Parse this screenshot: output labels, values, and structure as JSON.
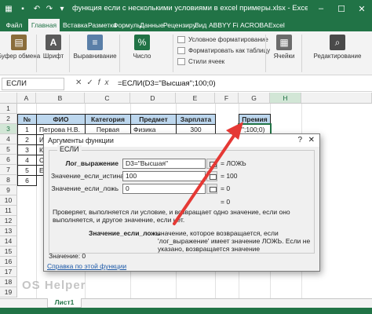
{
  "window": {
    "title": "функция если с несколькими условиями в excel примеры.xlsx - Excel",
    "save_icon": "save-icon",
    "undo_icon": "undo-icon",
    "redo_icon": "redo-icon",
    "accent": "#217346"
  },
  "ribbon_tabs": [
    "Файл",
    "Главная",
    "Вставка",
    "Разметка",
    "Формулы",
    "Данные",
    "Рецензиру",
    "Вид",
    "ABBYY Fi",
    "ACROBA",
    "Excel"
  ],
  "ribbon": {
    "clipboard": "Буфер обмена",
    "font": "Шрифт",
    "alignment": "Выравнивание",
    "number": "Число",
    "cond_format": "Условное форматирование",
    "format_table": "Форматировать как таблицу",
    "cell_styles": "Стили ячеек",
    "cells": "Ячейки",
    "editing": "Редактирование"
  },
  "formula_bar": {
    "name_box": "ЕСЛИ",
    "formula": "=ЕСЛИ(D3=\"Высшая\";100;0)"
  },
  "grid": {
    "columns": [
      "A",
      "B",
      "C",
      "D",
      "E",
      "F",
      "G",
      "H"
    ],
    "rows": [
      "1",
      "2",
      "3",
      "4",
      "5",
      "6",
      "7",
      "8",
      "9",
      "10",
      "11",
      "12",
      "13",
      "14",
      "15",
      "16",
      "17",
      "18",
      "19"
    ],
    "table_headers": [
      "№",
      "ФИО",
      "Категория",
      "Предмет",
      "Зарплата",
      "Премия"
    ],
    "row3": {
      "num": "1",
      "name": "Петрова Н.В.",
      "category": "Первая",
      "subject": "Физика",
      "salary": "300",
      "bonus": "\";100;0)"
    },
    "row_numbers": [
      "2",
      "3",
      "4",
      "5",
      "6"
    ],
    "name_initials": [
      "И",
      "К",
      "С",
      "Е"
    ]
  },
  "dialog": {
    "title": "Аргументы функции",
    "help": "?",
    "close": "✕",
    "function_name": "ЕСЛИ",
    "args": [
      {
        "label": "Лог_выражение",
        "value": "D3=\"Высшая\"",
        "result": "=  ЛОЖЬ"
      },
      {
        "label": "Значение_если_истина",
        "value": "100",
        "result": "=  100"
      },
      {
        "label": "Значение_если_ложь",
        "value": "0",
        "result": "=  0"
      }
    ],
    "result_line": "=  0",
    "description": "Проверяет, выполняется ли условие, и возвращает одно значение, если оно выполняется, и другое значение, если нет.",
    "arg_desc_name": "Значение_если_ложь",
    "arg_desc_text": "значение, которое возвращается, если 'лог_выражение' имеет значение ЛОЖЬ. Если не указано, возвращается значение",
    "value_label": "Значение:  0",
    "help_link": "Справка по этой функции"
  },
  "sheet_tab": "Лист1",
  "watermark": "OS Helper"
}
